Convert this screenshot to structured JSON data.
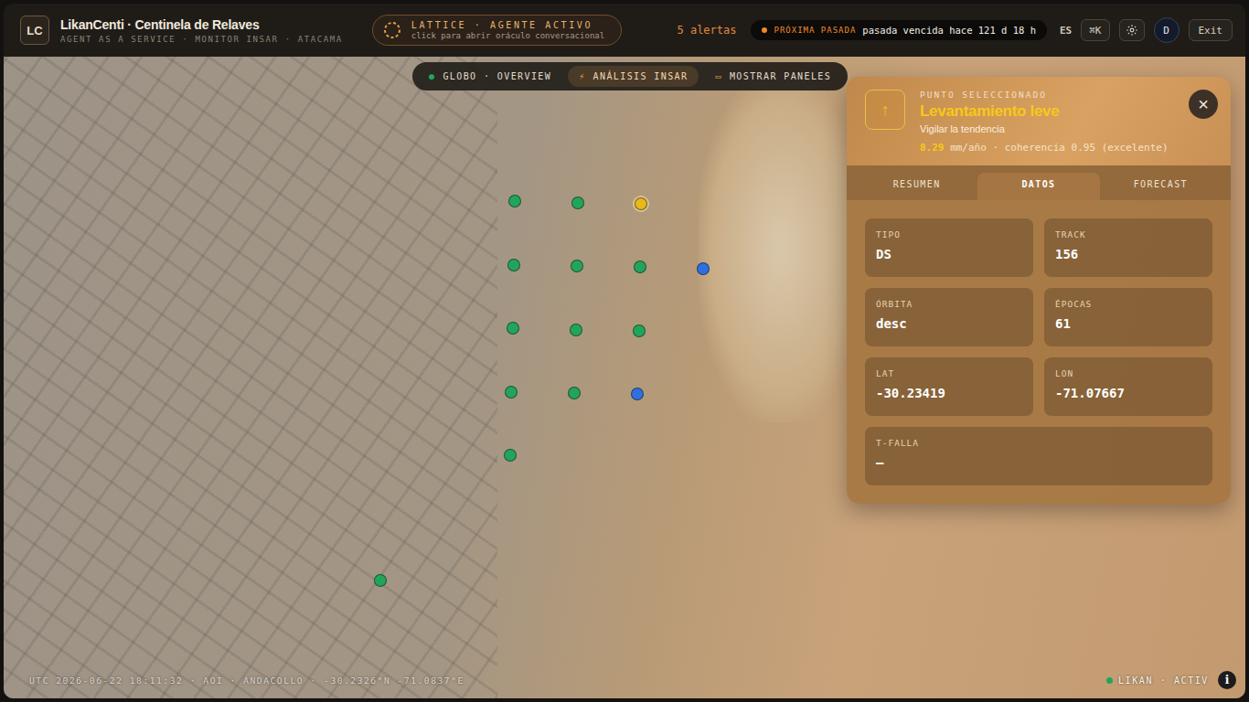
{
  "header": {
    "logo": "LC",
    "title": "LikanCenti · Centinela de Relaves",
    "subtitle": "AGENT AS A SERVICE · MONITOR INSAR · ATACAMA",
    "agent": {
      "title": "LATTICE · AGENTE ACTIVO",
      "hint": "click para abrir oráculo conversacional"
    },
    "alerts": "5 alertas",
    "next_pass": {
      "label": "PRÓXIMA PASADA",
      "value": "pasada vencida hace 121 d 18 h",
      "color": "#f08a24"
    },
    "language": "ES",
    "shortcut": "⌘K",
    "avatar": "D",
    "exit": "Exit"
  },
  "toolbar": [
    {
      "label": "GLOBO · OVERVIEW",
      "icon": "●",
      "selected": false
    },
    {
      "label": "ANÁLISIS INSAR",
      "icon": "⚡",
      "selected": true
    },
    {
      "label": "MOSTRAR PANELES",
      "icon": "▭",
      "selected": false
    }
  ],
  "pins": [
    {
      "color": "#22a55b",
      "selected": false
    },
    {
      "color": "#22a55b",
      "selected": false
    },
    {
      "color": "#e8b81c",
      "selected": true
    },
    {
      "color": "#22a55b",
      "selected": false
    },
    {
      "color": "#22a55b",
      "selected": false
    },
    {
      "color": "#22a55b",
      "selected": false
    },
    {
      "color": "#2f6fe0",
      "selected": false
    },
    {
      "color": "#22a55b",
      "selected": false
    },
    {
      "color": "#22a55b",
      "selected": false
    },
    {
      "color": "#22a55b",
      "selected": false
    },
    {
      "color": "#22a55b",
      "selected": false
    },
    {
      "color": "#22a55b",
      "selected": false
    },
    {
      "color": "#2f6fe0",
      "selected": false
    },
    {
      "color": "#22a55b",
      "selected": false
    },
    {
      "color": "#22a55b",
      "selected": false
    }
  ],
  "panel": {
    "eyebrow": "PUNTO SELECCIONADO",
    "icon": "↑",
    "title": "Levantamiento leve",
    "subtitle": "Vigilar la tendencia",
    "rate": "8.29",
    "rate_rest": "mm/año · coherencia 0.95 (excelente)",
    "close": "×",
    "tabs": [
      {
        "label": "RESUMEN",
        "selected": false
      },
      {
        "label": "DATOS",
        "selected": true
      },
      {
        "label": "FORECAST",
        "selected": false
      }
    ],
    "fields": [
      {
        "label": "TIPO",
        "value": "DS"
      },
      {
        "label": "TRACK",
        "value": "156"
      },
      {
        "label": "ÓRBITA",
        "value": "desc"
      },
      {
        "label": "ÉPOCAS",
        "value": "61"
      },
      {
        "label": "LAT",
        "value": "-30.23419"
      },
      {
        "label": "LON",
        "value": "-71.07667"
      },
      {
        "label": "T-FALLA",
        "value": "—",
        "wide": true
      }
    ]
  },
  "footer": {
    "coords": "UTC 2026-06-22 18:11:32 · AOI · ANDACOLLO · -30.2326°N -71.0837°E",
    "status": "LIKAN · ACTIV",
    "status_color": "#22a55b",
    "info": "i"
  }
}
